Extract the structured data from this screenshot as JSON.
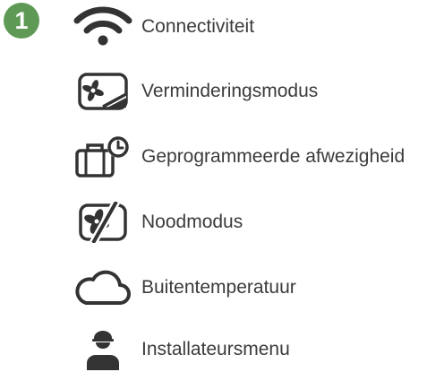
{
  "step": {
    "number": "1",
    "color": "#5e9a55"
  },
  "menu": {
    "icon_color": "#333333",
    "items": [
      {
        "icon": "wifi-icon",
        "label": "Connectiviteit"
      },
      {
        "icon": "reduced-mode-fan-icon",
        "label": "Verminderingsmodus"
      },
      {
        "icon": "suitcase-clock-icon",
        "label": "Geprogrammeerde afwezigheid"
      },
      {
        "icon": "emergency-mode-fan-icon",
        "label": "Noodmodus"
      },
      {
        "icon": "cloud-icon",
        "label": "Buitentemperatuur"
      },
      {
        "icon": "installer-icon",
        "label": "Installateursmenu"
      }
    ]
  }
}
